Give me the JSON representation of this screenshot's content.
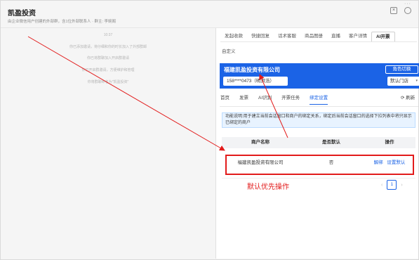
{
  "header": {
    "title": "凯盈投资",
    "subtitle": "由企业微信用户创建的外部群，含1位外部联系人 · 群主: 李婉阁",
    "more": "···"
  },
  "chat": {
    "time": "10:37",
    "lines": [
      "你已添加邀请，将仔细和你的时长加入了外部群邮",
      "你已将群聊加入开启群邀请",
      "你已开启群邀请，方便维护和管理",
      "你将群聊命名为\"凯盈投资\""
    ]
  },
  "tabs": [
    "发起收款",
    "快捷回复",
    "话术客服",
    "商品图册",
    "直播",
    "客户详情",
    "AI开票"
  ],
  "active_tab": "AI开票",
  "tab_row2": "自定义",
  "banner": {
    "company": "福建凯盈投资有限公司",
    "role_button": "角色切换",
    "account": "158****0473（明洪浩）",
    "store": "默认门店",
    "store_caret": "▾"
  },
  "subnav": {
    "items": [
      "首页",
      "发票",
      "AI识别",
      "开票任务",
      "绑定设置"
    ],
    "active": "绑定设置",
    "refresh": "刷新"
  },
  "info_text": "功能说明:用于建立当前会话窗口和商户的绑定关系，绑定后当前会话窗口的选择下拉列表中将只显示已绑定的商户",
  "table": {
    "headers": [
      "商户名称",
      "是否默认",
      "操作"
    ],
    "rows": [
      {
        "name": "福建凯盈投资有限公司",
        "default": "否",
        "actions": [
          "解绑",
          "设置默认"
        ]
      }
    ]
  },
  "pagination": {
    "prev": "‹",
    "current": "1",
    "next": "›"
  },
  "annotation": "默认优先操作",
  "colors": {
    "primary": "#1b63e6",
    "annotation": "#e21b1b",
    "info_bg": "#e8f3ff"
  }
}
